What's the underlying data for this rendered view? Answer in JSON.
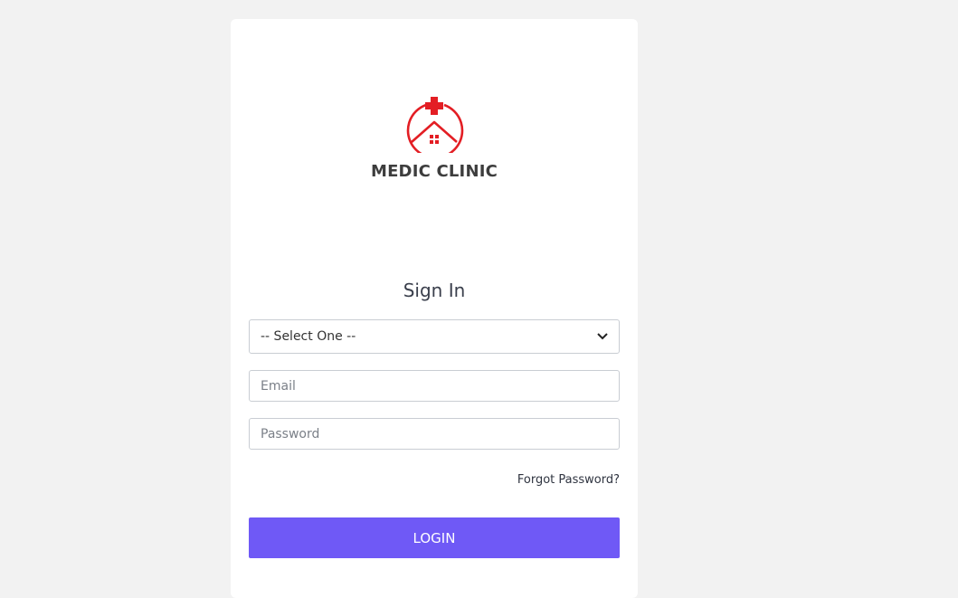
{
  "brand": {
    "name": "MEDIC CLINIC",
    "logo_icon": "house-cross-icon",
    "accent_color": "#e31e24"
  },
  "form": {
    "title": "Sign In",
    "role_select": {
      "selected": "-- Select One --"
    },
    "email": {
      "placeholder": "Email"
    },
    "password": {
      "placeholder": "Password"
    },
    "forgot_label": "Forgot Password?",
    "login_label": "LOGIN",
    "login_color": "#6f59f6"
  }
}
